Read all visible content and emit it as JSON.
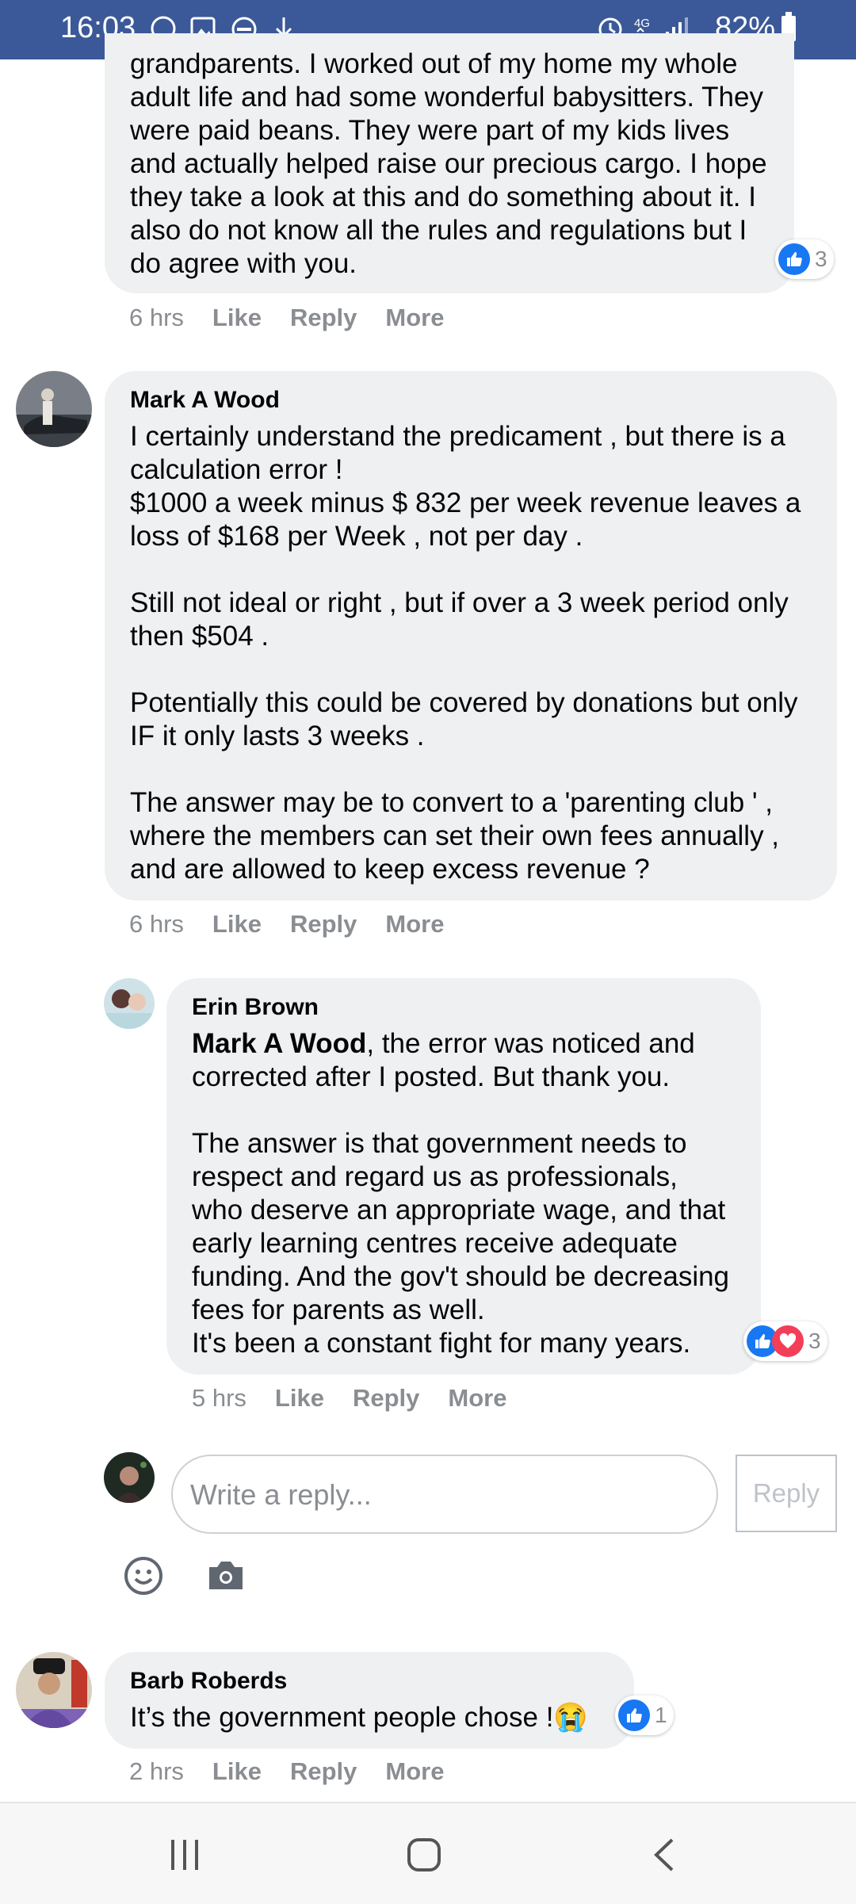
{
  "status_bar": {
    "time": "16:03",
    "network": "4G",
    "battery": "82%"
  },
  "comments": [
    {
      "author": "",
      "text": "grandparents. I worked out of my home my whole adult life and had some wonderful babysitters. They were paid beans. They were part of my kids lives and actually helped raise our precious cargo. I hope they take a look at this and do something about it. I also do not know all the rules and regulations but I do agree with you.",
      "time": "6 hrs",
      "like": "Like",
      "reply": "Reply",
      "more": "More",
      "reactions": "3"
    },
    {
      "author": "Mark A Wood",
      "text": "I certainly understand the predicament , but there is a calculation error !\n$1000 a week minus $ 832 per week revenue leaves a loss of $168 per Week , not per day .\n\nStill not ideal or right , but if over a 3 week period only then $504 .\n\nPotentially this could be covered by donations but only IF it only lasts 3 weeks .\n\nThe answer may be to convert to a 'parenting club ' , where the members can set their own fees annually , and are allowed to keep excess revenue ?",
      "time": "6 hrs",
      "like": "Like",
      "reply": "Reply",
      "more": "More"
    },
    {
      "author": "Erin Brown",
      "mention": "Mark A Wood",
      "text": ", the error was noticed and corrected after I posted. But thank you.\n\nThe answer is that government needs to respect and regard us as professionals, who deserve an appropriate wage, and that early learning centres receive adequate funding. And the gov't should be decreasing fees for parents as well.\nIt's been a constant fight for many years.",
      "time": "5 hrs",
      "like": "Like",
      "reply": "Reply",
      "more": "More",
      "reactions": "3"
    },
    {
      "author": "Barb Roberds",
      "text": "It’s the government people chose !😭",
      "time": "2 hrs",
      "like": "Like",
      "reply": "Reply",
      "more": "More",
      "reactions": "1"
    }
  ],
  "reply_box": {
    "placeholder": "Write a reply...",
    "button": "Reply"
  },
  "icons": [
    "whatsapp-icon",
    "gallery-icon",
    "dnd-icon",
    "download-icon",
    "alarm-icon",
    "signal-icon",
    "battery-icon",
    "like-icon",
    "love-icon",
    "emoji-icon",
    "camera-icon",
    "recents-icon",
    "home-icon",
    "back-icon"
  ]
}
